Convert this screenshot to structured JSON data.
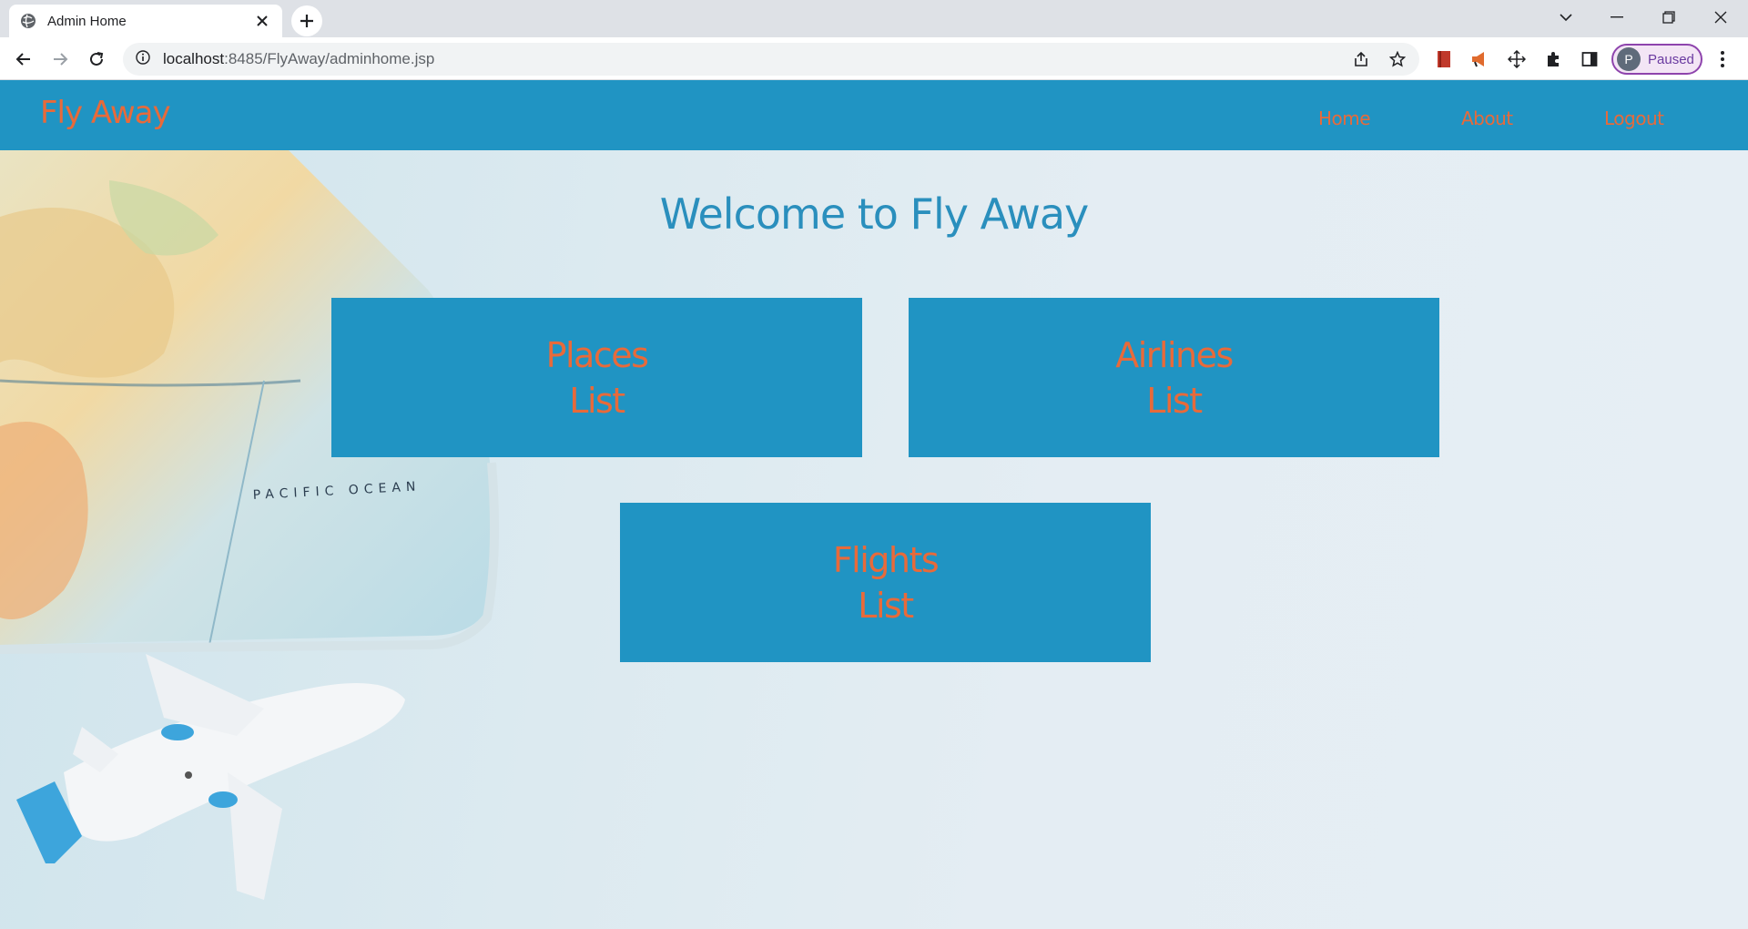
{
  "browser": {
    "tab_title": "Admin Home",
    "url_host": "localhost",
    "url_rest": ":8485/FlyAway/adminhome.jsp",
    "profile_initial": "P",
    "profile_status": "Paused"
  },
  "navbar": {
    "brand": "Fly Away",
    "links": [
      "Home",
      "About",
      "Logout"
    ]
  },
  "main": {
    "heading": "Welcome to Fly Away",
    "cards": [
      {
        "line1": "Places",
        "line2": "List"
      },
      {
        "line1": "Airlines",
        "line2": "List"
      },
      {
        "line1": "Flights",
        "line2": "List"
      }
    ]
  },
  "background": {
    "map_label": "PACIFIC OCEAN"
  },
  "colors": {
    "primary": "#2094c3",
    "accent": "#e86a3a",
    "heading": "#2a8fbd"
  }
}
